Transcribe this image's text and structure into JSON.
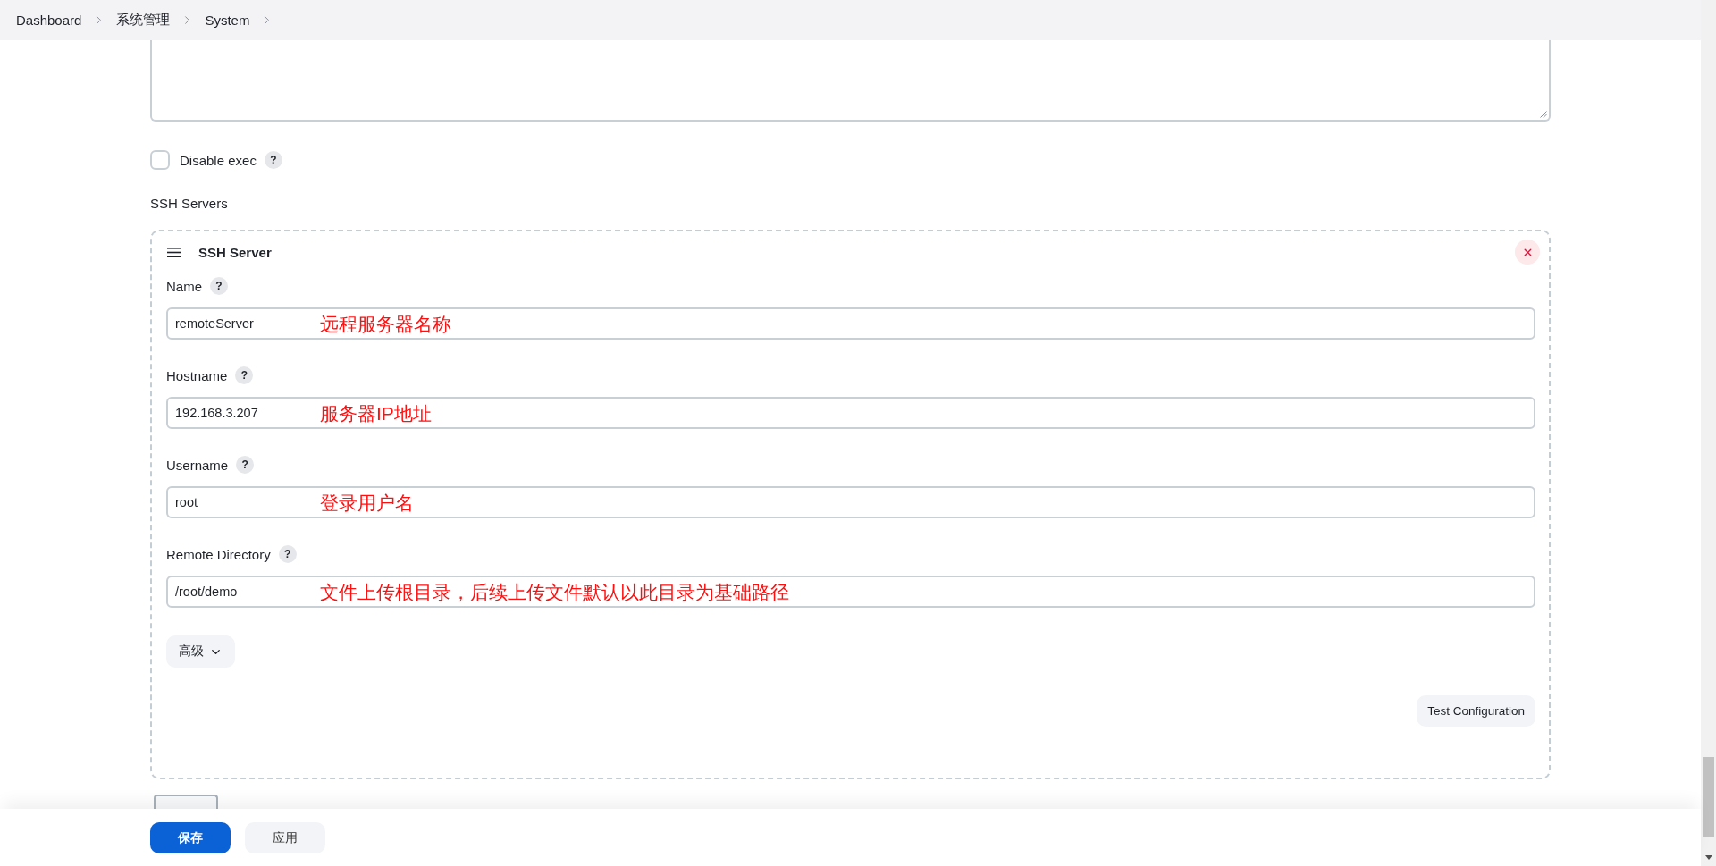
{
  "breadcrumbs": [
    {
      "label": "Dashboard"
    },
    {
      "label": "系统管理"
    },
    {
      "label": "System"
    }
  ],
  "command_field": {
    "resizable": true
  },
  "disable_exec": {
    "label": "Disable exec",
    "checked": false,
    "help": "?"
  },
  "ssh_servers": {
    "label": "SSH Servers",
    "servers": [
      {
        "title": "SSH Server",
        "fields": [
          {
            "label": "Name",
            "help": "?",
            "value": "remoteServer",
            "annotation": "远程服务器名称"
          },
          {
            "label": "Hostname",
            "help": "?",
            "value": "192.168.3.207",
            "annotation": "服务器IP地址"
          },
          {
            "label": "Username",
            "help": "?",
            "value": "root",
            "annotation": "登录用户名"
          },
          {
            "label": "Remote Directory",
            "help": "?",
            "value": "/root/demo",
            "annotation": "文件上传根目录，后续上传文件默认以此目录为基础路径"
          }
        ],
        "advanced_button": "高级",
        "test_button": "Test Configuration"
      }
    ]
  },
  "add_button": {
    "covered": true
  },
  "footer": {
    "buttons": [
      {
        "label": "保存",
        "kind": "primary"
      },
      {
        "label": "应用",
        "kind": "secondary"
      }
    ]
  }
}
